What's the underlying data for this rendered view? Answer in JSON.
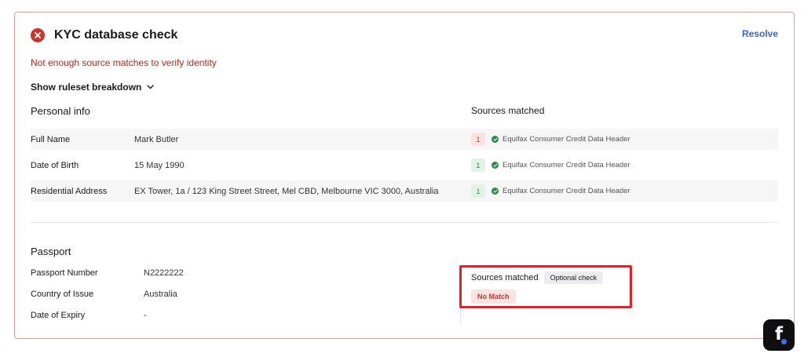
{
  "header": {
    "title": "KYC database check",
    "status_icon": "x-circle-icon",
    "resolve_label": "Resolve"
  },
  "error_message": "Not enough source matches to verify identity",
  "breakdown_toggle": "Show ruleset breakdown",
  "personal": {
    "section_title": "Personal info",
    "sources_heading": "Sources matched",
    "rows": [
      {
        "label": "Full Name",
        "value": "Mark Butler",
        "count": "1",
        "count_status": "red",
        "source": "Equifax Consumer Credit Data Header"
      },
      {
        "label": "Date of Birth",
        "value": "15 May 1990",
        "count": "1",
        "count_status": "green",
        "source": "Equifax Consumer Credit Data Header"
      },
      {
        "label": "Residential Address",
        "value": "EX Tower, 1a / 123 King Street Street, Mel CBD, Melbourne VIC 3000, Australia",
        "count": "1",
        "count_status": "green",
        "source": "Equifax Consumer Credit Data Header"
      }
    ]
  },
  "passport": {
    "section_title": "Passport",
    "rows": [
      {
        "label": "Passport Number",
        "value": "N2222222"
      },
      {
        "label": "Country of Issue",
        "value": "Australia"
      },
      {
        "label": "Date of Expiry",
        "value": "-"
      }
    ],
    "sources_heading": "Sources matched",
    "optional_badge": "Optional check",
    "match_status": "No Match"
  },
  "colors": {
    "accent": "#3b63d6",
    "error": "#b3271c",
    "success": "#2c8a48",
    "highlight": "#ee1c24"
  },
  "fab_letter": "f"
}
